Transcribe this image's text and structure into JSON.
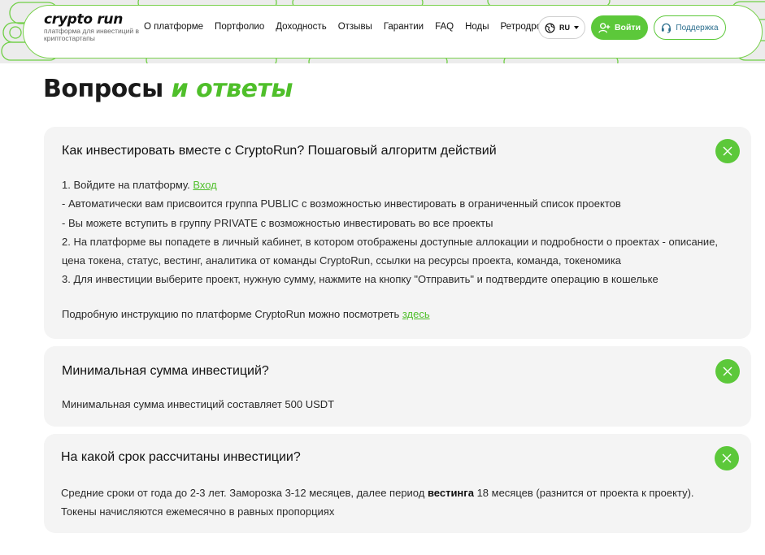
{
  "colors": {
    "accent": "#5cc83a",
    "header_bg": "#ececec",
    "card_bg": "#f4f4f4",
    "support_text": "#2d6f8e"
  },
  "header": {
    "logo_text": "crypto run",
    "logo_tagline": "платформа для инвестиций в криптостартапы",
    "nav": [
      "О платформе",
      "Портфолио",
      "Доходность",
      "Отзывы",
      "Гарантии",
      "FAQ",
      "Ноды",
      "Ретродропы"
    ],
    "lang": {
      "label": "RU",
      "icon": "globe-icon",
      "caret_icon": "caret-down-icon"
    },
    "login": {
      "label": "Войти",
      "icon": "user-plus-icon"
    },
    "support": {
      "label": "Поддержка",
      "icon": "headset-icon"
    }
  },
  "page": {
    "title_part1": "Вопросы",
    "title_part2": "и ответы"
  },
  "faq": [
    {
      "question": "Как инвестировать вместе с CryptoRun? Пошаговый алгоритм действий",
      "toggle_icon": "close-icon",
      "lines": {
        "l1_prefix": "1. Войдите на платформу.",
        "l1_link": "Вход",
        "l2": "- Автоматически вам присвоится группа PUBLIC с возможностью инвестировать в ограниченный список проектов",
        "l3": "- Вы можете вступить в группу PRIVATE с возможностью инвестировать во все проекты",
        "l4": "2. На платформе вы попадете в личный кабинет, в котором отображены доступные аллокации и подробности о проектах - описание,",
        "l5": "цена токена, статус, вестинг, аналитика от команды CryptoRun, ссылки на ресурсы проекта, команда, токеномика",
        "l6": "3. Для инвестиции выберите проект, нужную сумму, нажмите на кнопку \"Отправить\" и подтвердите операцию в кошельке",
        "l7_prefix": "Подробную инструкцию по платформе CryptoRun можно посмотреть",
        "l7_link": "здесь"
      }
    },
    {
      "question": "Минимальная сумма инвестиций?",
      "toggle_icon": "close-icon",
      "answer": "Минимальная сумма инвестиций составляет 500 USDT"
    },
    {
      "question": "На какой срок рассчитаны инвестиции?",
      "toggle_icon": "close-icon",
      "lines": {
        "l1_prefix": "Средние сроки от года до 2-3 лет. Заморозка 3-12 месяцев, далее период",
        "l1_bold": "вестинга",
        "l1_suffix": "18 месяцев (разнится от проекта к проекту).",
        "l2": "Токены начисляются ежемесячно в равных пропорциях"
      }
    }
  ]
}
